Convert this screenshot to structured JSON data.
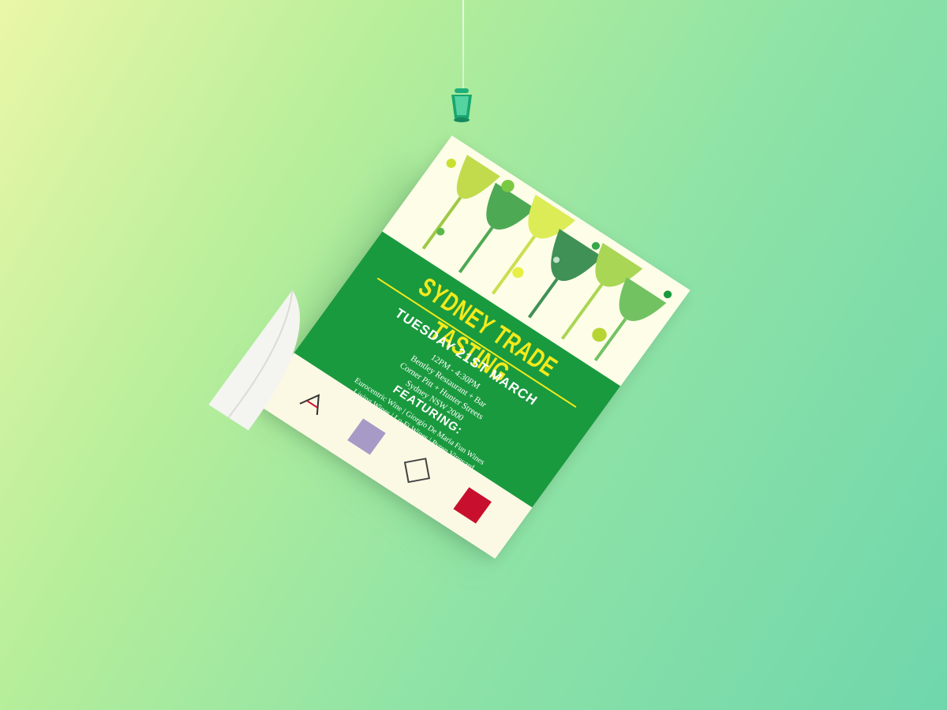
{
  "scene": {
    "background_colors": [
      "#eaf7a8",
      "#8fe3a6",
      "#6fd6ac"
    ],
    "accent_color": "#1a9a3e",
    "title_color": "#f2ea1c"
  },
  "poster": {
    "title": "SYDNEY TRADE TASTING",
    "date": "TUESDAY 21ST MARCH",
    "time": "12PM - 4:30PM",
    "venue": "Bentley Restaurant + Bar",
    "address_line": "Corner Pitt + Hunter Streets",
    "city": "Sydney NSW 2000",
    "featuring_heading": "FEATURING:",
    "featuring_line_1": "Eurocentric Wine | Giorgio De Maria Fun Wines",
    "featuring_line_2": "Living Wines | Lo-Fi Wines | Pyren Vineyard",
    "logo_icons": [
      "lw-logo-icon",
      "lofi-logo-icon",
      "pyren-logo-icon"
    ]
  }
}
